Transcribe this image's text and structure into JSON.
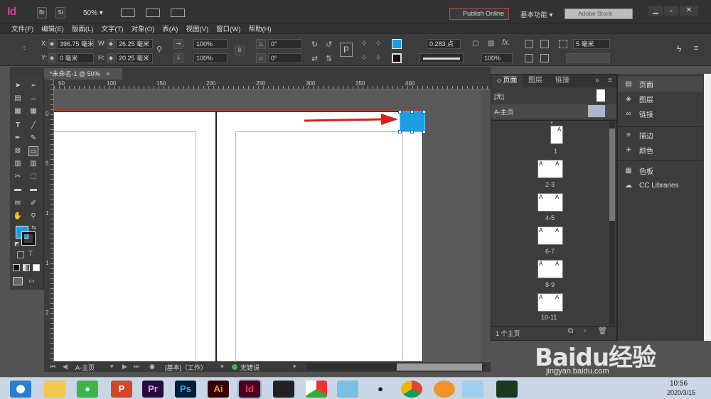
{
  "app": {
    "logo": "Id",
    "bridge_btn": "Br",
    "stock_btn": "St",
    "zoom": "50%",
    "publish_online": "Publish Online",
    "workspace": "基本功能",
    "search_placeholder": "Adobe Stock"
  },
  "menu": [
    "文件(F)",
    "编辑(E)",
    "版面(L)",
    "文字(T)",
    "对象(O)",
    "表(A)",
    "视图(V)",
    "窗口(W)",
    "帮助(H)"
  ],
  "control": {
    "x_label": "X:",
    "x_value": "396.75 毫米",
    "y_label": "Y:",
    "y_value": "0 毫米",
    "w_label": "W:",
    "w_value": "26.25 毫米",
    "h_label": "H:",
    "h_value": "20.25 毫米",
    "scale_x": "100%",
    "scale_y": "100%",
    "rotate": "0°",
    "shear": "0°",
    "stroke_weight": "0.283 点",
    "opacity": "100%",
    "offset": "5 毫米"
  },
  "doc_tab": {
    "title": "*未命名-1 @ 50%",
    "close": "×"
  },
  "ruler_h": [
    "50",
    "100",
    "150",
    "200",
    "250",
    "300",
    "350",
    "400"
  ],
  "ruler_v": [
    "0",
    "5",
    "1",
    "1",
    "2"
  ],
  "status": {
    "page": "A-主页",
    "style": "[基本]（工作）",
    "preflight": "无错误"
  },
  "pages_panel": {
    "tabs": [
      "页面",
      "图层",
      "链接"
    ],
    "none_master": "[无]",
    "a_master": "A-主页",
    "page_labels": [
      "1",
      "2-3",
      "4-5",
      "6-7",
      "8-9",
      "10-11"
    ],
    "footer": "1 个主页",
    "thumb_letter": "A"
  },
  "dock": {
    "items": [
      {
        "icon": "pages-icon",
        "label": "页面"
      },
      {
        "icon": "layers-icon",
        "label": "图层"
      },
      {
        "icon": "links-icon",
        "label": "链接"
      },
      {
        "icon": "stroke-icon",
        "label": "描边"
      },
      {
        "icon": "color-icon",
        "label": "颜色"
      },
      {
        "icon": "swatches-icon",
        "label": "色板"
      },
      {
        "icon": "cc-libraries-icon",
        "label": "CC Libraries"
      }
    ]
  },
  "taskbar": {
    "pr": "Pr",
    "ps": "Ps",
    "ai": "Ai",
    "id": "Id",
    "time": "10:56",
    "date": "2020/3/15"
  },
  "watermark": {
    "brand": "Baidu经验",
    "url": "jingyan.baidu.com"
  },
  "colors": {
    "accent_blue": "#1a9fe3",
    "arrow_red": "#d81e1e",
    "id_pink": "#d03c8b"
  }
}
